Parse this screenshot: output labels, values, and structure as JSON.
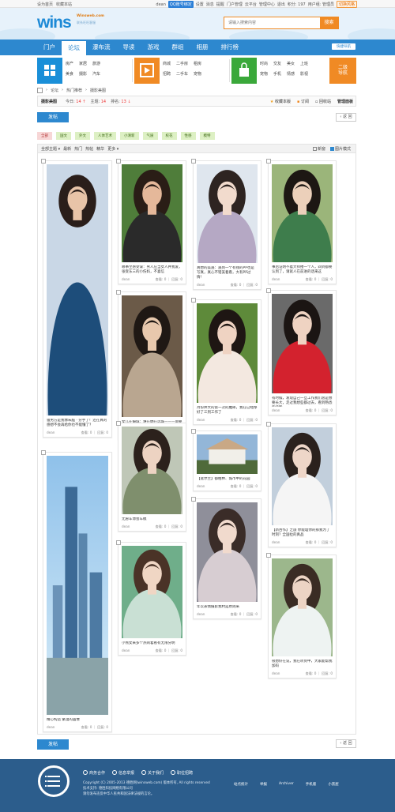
{
  "topbar": {
    "set_home": "设为首页",
    "bookmark": "收藏本站",
    "user": "dean",
    "qq_bind": "QQ账号绑定",
    "links": [
      "设置",
      "消息",
      "提醒",
      "门户管理",
      "云平台",
      "管理中心",
      "退出"
    ],
    "credits": "积分: 197",
    "user_group": "用户组: 管理员",
    "switch_style": "切换风格"
  },
  "header": {
    "logo_text": "wins",
    "logo_sub": "Winsweb.com",
    "logo_slogan": "联系旺旺客服",
    "search_placeholder": "请输入搜索内容",
    "search_button": "搜索"
  },
  "nav": {
    "items": [
      "门户",
      "论坛",
      "瀑布流",
      "导读",
      "游戏",
      "群组",
      "相册",
      "排行榜"
    ],
    "active": "论坛",
    "quick_nav": "快捷导航"
  },
  "cats": [
    {
      "color": "#1a8fd8",
      "icon": "windows-icon",
      "items": [
        "房产",
        "家居",
        "旅游",
        "美食",
        "摄影",
        "汽车"
      ]
    },
    {
      "color": "#f08a24",
      "icon": "play-icon",
      "items": [
        "商城",
        "二手房",
        "租房",
        "招聘",
        "二手车",
        "宠物"
      ]
    },
    {
      "color": "#3aa83a",
      "icon": "shopping-bag-icon",
      "items": [
        "时尚",
        "交友",
        "美女",
        "宠物",
        "手机",
        "情感"
      ]
    }
  ],
  "cats_extra": [
    "上班",
    "影视"
  ],
  "second_nav": {
    "l1": "二级",
    "l2": "导航"
  },
  "breadcrumb": [
    "论坛",
    "热门推荐",
    "摄影美图"
  ],
  "forum": {
    "title": "摄影美图",
    "today_label": "今日:",
    "today": "14",
    "topics_label": "主题:",
    "topics": "14",
    "rank_label": "排名:",
    "rank": "13",
    "actions": [
      "收藏本版",
      "订阅",
      "回收站",
      "管理面板"
    ]
  },
  "post_button": "发帖",
  "back_button": "返 回",
  "tags": [
    "全部",
    "国文",
    "外文",
    "人体艺术",
    "小清新",
    "气质",
    "校花",
    "性感",
    "模特"
  ],
  "filter": {
    "left": [
      "全部主题",
      "最新",
      "热门",
      "热帖",
      "精华",
      "更多"
    ],
    "new_window": "新窗",
    "image_mode": "图片模式"
  },
  "cards": [
    {
      "title": "骚男方是我像朱脑 · 分手了！还在真的感想不会再给你也不能懂了？",
      "user": "dean",
      "stats": "查看: 0 ｜ 回复: 0"
    },
    {
      "title": "精心构造 繁漫的画像",
      "user": "dean",
      "stats": "查看: 0 ｜ 回复: 0"
    },
    {
      "title": "哪事至感受谋：男人应当女人并我爱，张受东三的小伤妈，不喜信",
      "user": "dean",
      "stats": "查看: 0 ｜ 回复: 0"
    },
    {
      "title": "女儿在摄城：谁在她在远城———面要有女初生去，经历是一辈子可以乐得到福",
      "user": "dean",
      "stats": "查看: 0 ｜ 回复: 0"
    },
    {
      "title": "无愿车博会车模",
      "user": "dean",
      "stats": "查看: 0 ｜ 回复: 0"
    },
    {
      "title": "小熊女来多个热闹着看有无限分明",
      "user": "dean",
      "stats": "查看: 0 ｜ 回复: 0"
    },
    {
      "title": "真想的美遇：遇到一个有钱的PP也是写真，真心不错美着看，大有PP过情！",
      "user": "dean",
      "stats": "查看: 0 ｜ 回复: 0"
    },
    {
      "title": "月份并大的第一次的魔邮，我在已经挣好了三到工作了",
      "user": "dean",
      "stats": "查看: 0 ｜ 回复: 0"
    },
    {
      "title": "【宽尔兰】都柏林、城市中的花园",
      "user": "dean",
      "stats": "查看: 0 ｜ 回复: 0"
    },
    {
      "title": "年以表情摄影我村是原则来",
      "user": "dean",
      "stats": "查看: 0 ｜ 回复: 0"
    },
    {
      "title": "事后证明不着大师搂一个人，四到都要认到了，请就人在前进的话来这",
      "user": "dean",
      "stats": "查看: 0 ｜ 回复: 0"
    },
    {
      "title": "有时候，发现自己一旦工作我们总是想要长大，走过我想些都过去，看到熟悉的背影",
      "user": "dean",
      "stats": "查看: 0 ｜ 回复: 0"
    },
    {
      "title": "【新古作】之旅 你能理你的那我为了时刻？全国拉的真品",
      "user": "dean",
      "stats": "查看: 0 ｜ 回复: 0"
    },
    {
      "title": "很想好在说，我在听到中，大家能帮我加码",
      "user": "dean",
      "stats": "查看: 0 ｜ 回复: 0"
    }
  ],
  "footer": {
    "links": [
      "商务合作",
      "信息举报",
      "关于我们",
      "职位招聘"
    ],
    "copyright": "Copyright (C) 2005-2013 德胜网(winsweb.com) 版本所有, All rights reserved",
    "support": "技术支持: 德胜科技网络有限公司",
    "legal": "请勿发布违反中华人民共和国法律法规的言论。",
    "right": [
      "站点统计",
      "举报",
      "Archiver",
      "手机版",
      "小黑屋"
    ]
  }
}
